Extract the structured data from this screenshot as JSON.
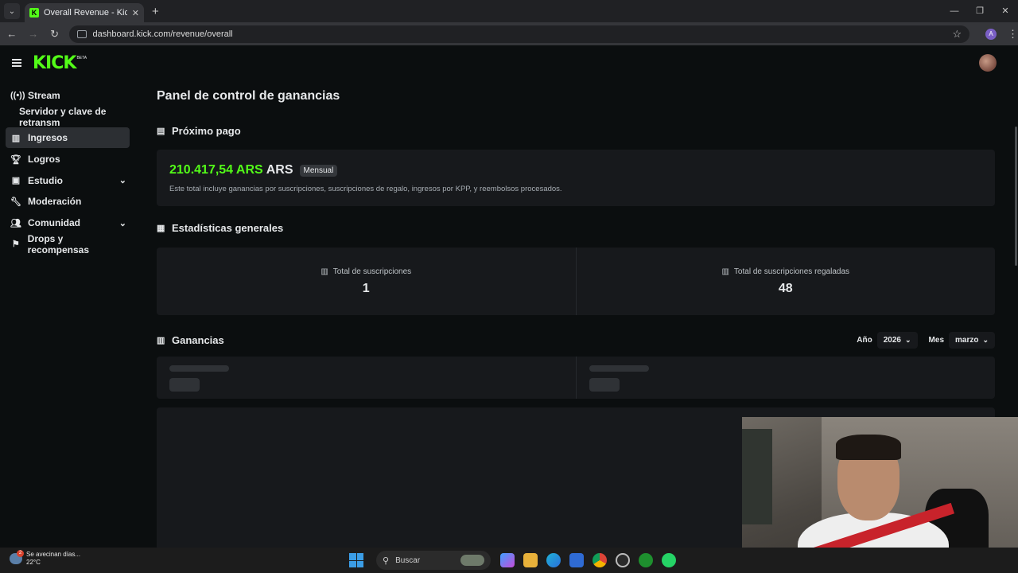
{
  "browser": {
    "tab_title": "Overall Revenue - Kick Dashbo",
    "url": "dashboard.kick.com/revenue/overall",
    "profile_initial": "A"
  },
  "brand": {
    "logo": "KICK",
    "beta": "BETA",
    "accent": "#53fc18"
  },
  "sidebar": {
    "items": [
      {
        "label": "Stream",
        "icon": "broadcast-icon"
      },
      {
        "label": "Servidor y clave de retransm"
      },
      {
        "label": "Ingresos",
        "icon": "chart-icon",
        "active": true
      },
      {
        "label": "Logros",
        "icon": "trophy-icon"
      },
      {
        "label": "Estudio",
        "icon": "studio-icon",
        "expandable": true
      },
      {
        "label": "Moderación",
        "icon": "wrench-icon"
      },
      {
        "label": "Comunidad",
        "icon": "community-icon",
        "expandable": true
      },
      {
        "label": "Drops y recompensas",
        "icon": "drops-icon"
      }
    ]
  },
  "main": {
    "title": "Panel de control de ganancias",
    "next_payout": {
      "section_title": "Próximo pago",
      "amount": "210.417,54 ARS",
      "currency": "ARS",
      "badge": "Mensual",
      "description": "Este total incluye ganancias por suscripciones, suscripciones de regalo, ingresos por KPP, y reembolsos procesados."
    },
    "stats": {
      "section_title": "Estadísticas generales",
      "total_subs_label": "Total de suscripciones",
      "total_subs_value": "1",
      "gifted_subs_label": "Total de suscripciones regaladas",
      "gifted_subs_value": "48"
    },
    "earnings": {
      "section_title": "Ganancias",
      "year_label": "Año",
      "year_value": "2026",
      "month_label": "Mes",
      "month_value": "marzo"
    }
  },
  "taskbar": {
    "weather_text": "Se avecinan días...",
    "temperature": "22°C",
    "notif_count": "2",
    "search_placeholder": "Buscar"
  }
}
